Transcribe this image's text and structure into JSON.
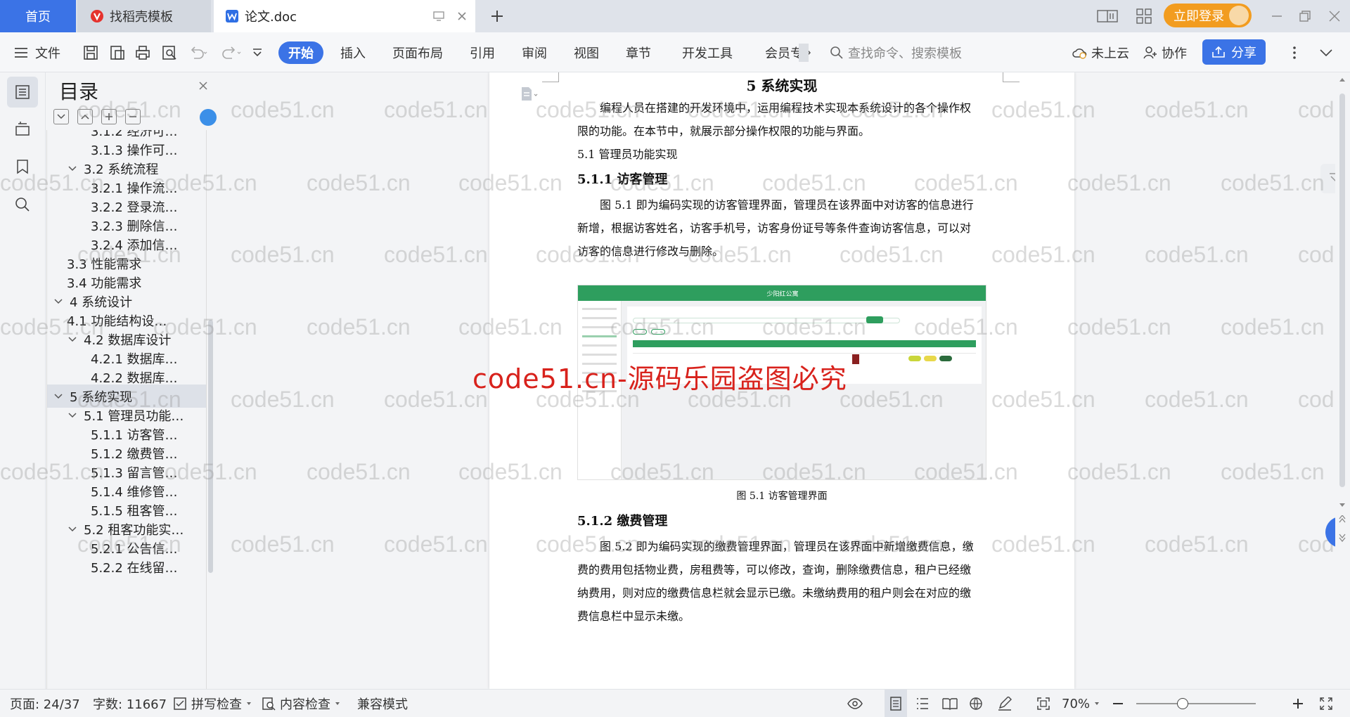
{
  "tabs": {
    "home": "首页",
    "templates": "找稻壳模板",
    "document": "论文.doc",
    "login": "立即登录"
  },
  "ribbon": {
    "file": "文件",
    "start": "开始",
    "insert": "插入",
    "layout": "页面布局",
    "references": "引用",
    "review": "审阅",
    "view": "视图",
    "chapter": "章节",
    "dev_tools": "开发工具",
    "member": "会员专",
    "search_placeholder": "查找命令、搜索模板",
    "cloud": "未上云",
    "collab": "协作",
    "share": "分享"
  },
  "toc": {
    "title": "目录",
    "items": [
      {
        "level": 3,
        "label": "3.1.2  经济可…",
        "expanded": null
      },
      {
        "level": 3,
        "label": "3.1.3  操作可…",
        "expanded": null
      },
      {
        "level": 2,
        "label": "3.2  系统流程",
        "expanded": true
      },
      {
        "level": 3,
        "label": "3.2.1  操作流…",
        "expanded": null
      },
      {
        "level": 3,
        "label": "3.2.2  登录流…",
        "expanded": null
      },
      {
        "level": 3,
        "label": "3.2.3  删除信…",
        "expanded": null
      },
      {
        "level": 3,
        "label": "3.2.4  添加信…",
        "expanded": null
      },
      {
        "level": 2,
        "label": "3.3  性能需求",
        "expanded": null
      },
      {
        "level": 2,
        "label": "3.4  功能需求",
        "expanded": null
      },
      {
        "level": 1,
        "label": "4  系统设计",
        "expanded": true
      },
      {
        "level": 2,
        "label": "4.1  功能结构设…",
        "expanded": null
      },
      {
        "level": 2,
        "label": "4.2  数据库设计",
        "expanded": true
      },
      {
        "level": 3,
        "label": "4.2.1  数据库…",
        "expanded": null
      },
      {
        "level": 3,
        "label": "4.2.2  数据库…",
        "expanded": null
      },
      {
        "level": 1,
        "label": "5  系统实现",
        "expanded": true,
        "active": true
      },
      {
        "level": 2,
        "label": "5.1  管理员功能…",
        "expanded": true
      },
      {
        "level": 3,
        "label": "5.1.1  访客管…",
        "expanded": null
      },
      {
        "level": 3,
        "label": "5.1.2  缴费管…",
        "expanded": null
      },
      {
        "level": 3,
        "label": "5.1.3  留言管…",
        "expanded": null
      },
      {
        "level": 3,
        "label": "5.1.4  维修管…",
        "expanded": null
      },
      {
        "level": 3,
        "label": "5.1.5  租客管…",
        "expanded": null
      },
      {
        "level": 2,
        "label": "5.2  租客功能实…",
        "expanded": true
      },
      {
        "level": 3,
        "label": "5.2.1  公告信…",
        "expanded": null
      },
      {
        "level": 3,
        "label": "5.2.2  在线留…",
        "expanded": null
      }
    ]
  },
  "doc": {
    "h1": "5  系统实现",
    "p1": [
      "编程人员在搭建的开发环境中，运用编程技术实现本系统设计的各个操作权",
      "限的功能。在本节中，就展示部分操作权限的功能与界面。"
    ],
    "h2": "5.1  管理员功能实现",
    "h3a": "5.1.1  访客管理",
    "p2": [
      "图 5.1  即为编码实现的访客管理界面，管理员在该界面中对访客的信息进行",
      "新增，根据访客姓名，访客手机号，访客身份证号等条件查询访客信息，可以对",
      "访客的信息进行修改与删除。"
    ],
    "fig_title": "少阳红公寓",
    "caption": "图 5.1  访客管理界面",
    "h3b": "5.1.2  缴费管理",
    "p3": [
      "图 5.2  即为编码实现的缴费管理界面，管理员在该界面中新增缴费信息，缴",
      "费的费用包括物业费，房租费等，可以修改，查询，删除缴费信息，租户已经缴",
      "纳费用，则对应的缴费信息栏就会显示已缴。未缴纳费用的租户则会在对应的缴",
      "费信息栏中显示未缴。"
    ]
  },
  "watermark": {
    "small": "code51.cn",
    "big": "code51.cn-源码乐园盗图必究"
  },
  "status": {
    "page": "页面: 24/37",
    "words": "字数: 11667",
    "spell": "拼写检查",
    "content_check": "内容检查",
    "compat": "兼容模式",
    "zoom": "70%"
  },
  "colors": {
    "accent": "#3b73e6",
    "login": "#f29c1f",
    "watermark_red": "#d8221c",
    "figure_green": "#2e9e5e"
  }
}
